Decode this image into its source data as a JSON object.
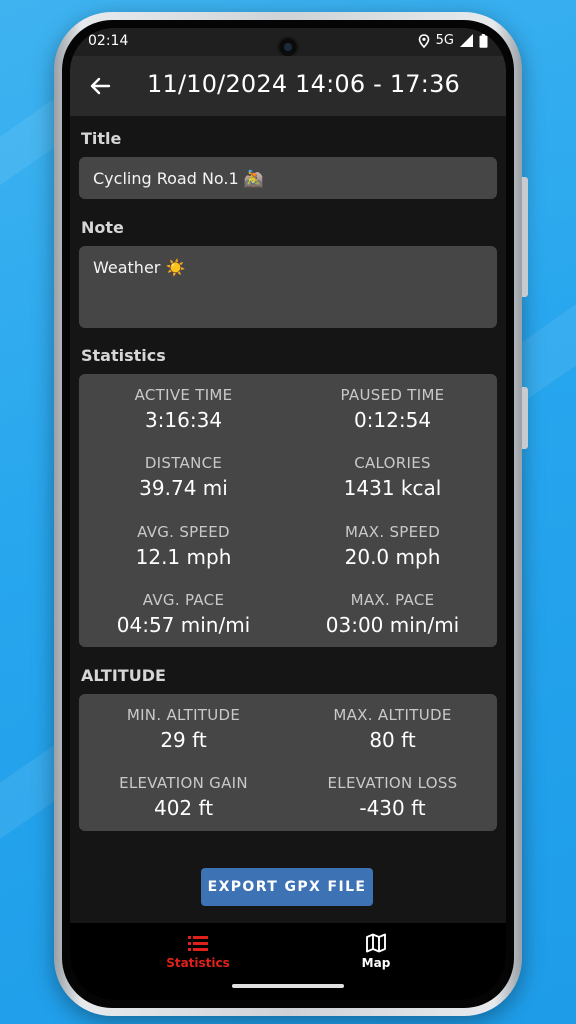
{
  "status_bar": {
    "time": "02:14",
    "network": "5G"
  },
  "app_bar": {
    "title": "11/10/2024 14:06 - 17:36"
  },
  "title_field": {
    "label": "Title",
    "value": "Cycling Road No.1 🚵"
  },
  "note_field": {
    "label": "Note",
    "value": "Weather ☀️"
  },
  "statistics": {
    "heading": "Statistics",
    "items": [
      {
        "label": "ACTIVE TIME",
        "value": "3:16:34"
      },
      {
        "label": "PAUSED TIME",
        "value": "0:12:54"
      },
      {
        "label": "DISTANCE",
        "value": "39.74 mi"
      },
      {
        "label": "CALORIES",
        "value": "1431 kcal"
      },
      {
        "label": "AVG. SPEED",
        "value": "12.1 mph"
      },
      {
        "label": "MAX. SPEED",
        "value": "20.0 mph"
      },
      {
        "label": "AVG. PACE",
        "value": "04:57 min/mi"
      },
      {
        "label": "MAX. PACE",
        "value": "03:00 min/mi"
      }
    ]
  },
  "altitude": {
    "heading": "ALTITUDE",
    "items": [
      {
        "label": "MIN. ALTITUDE",
        "value": "29 ft"
      },
      {
        "label": "MAX. ALTITUDE",
        "value": "80 ft"
      },
      {
        "label": "ELEVATION GAIN",
        "value": "402 ft"
      },
      {
        "label": "ELEVATION LOSS",
        "value": "-430 ft"
      }
    ]
  },
  "export_button": {
    "label": "EXPORT GPX FILE"
  },
  "bottom_nav": {
    "items": [
      {
        "label": "Statistics",
        "icon": "list-icon",
        "active": true
      },
      {
        "label": "Map",
        "icon": "map-icon",
        "active": false
      }
    ]
  },
  "colors": {
    "accent_active": "#e0211b",
    "button": "#3d72b5",
    "card": "#464646",
    "background": "#151515",
    "app_bar": "#2a2a2a"
  }
}
